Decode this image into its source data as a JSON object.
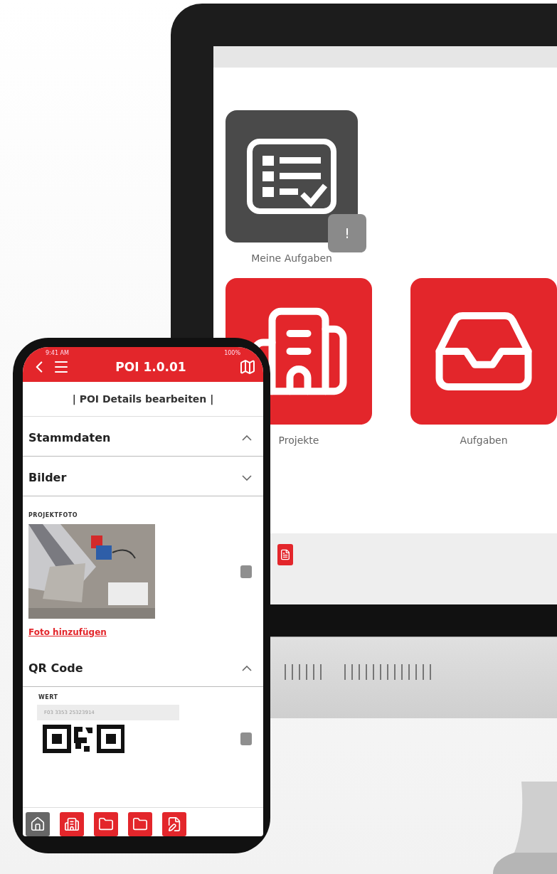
{
  "monitor": {
    "tiles": [
      {
        "kind": "tasks",
        "label": "Meine Aufgaben",
        "badge": "!",
        "color": "#4a4a4a"
      },
      {
        "kind": "building",
        "label": "Projekte",
        "color": "#e3262b"
      },
      {
        "kind": "inbox",
        "label": "Aufgaben",
        "color": "#e3262b"
      }
    ]
  },
  "phone": {
    "status": {
      "time": "9:41 AM",
      "battery": "100%"
    },
    "title": "POI 1.0.01",
    "subtitle": "| POI Details bearbeiten |",
    "sections": [
      {
        "kind": "header",
        "title": "Stammdaten",
        "expanded": true
      },
      {
        "kind": "header",
        "title": "Bilder",
        "expanded": false
      },
      {
        "label": "PROJEKTFOTO",
        "link": "Foto hinzufügen"
      },
      {
        "kind": "header",
        "title": "QR Code",
        "expanded": true
      },
      {
        "kind": "qr",
        "label": "WERT",
        "value": "F03 3353 25323914"
      }
    ],
    "nav": [
      {
        "kind": "home",
        "selected": true
      },
      {
        "kind": "building",
        "selected": false
      },
      {
        "kind": "folder",
        "selected": false
      },
      {
        "kind": "folder",
        "selected": false
      },
      {
        "kind": "edit",
        "selected": false
      }
    ]
  }
}
